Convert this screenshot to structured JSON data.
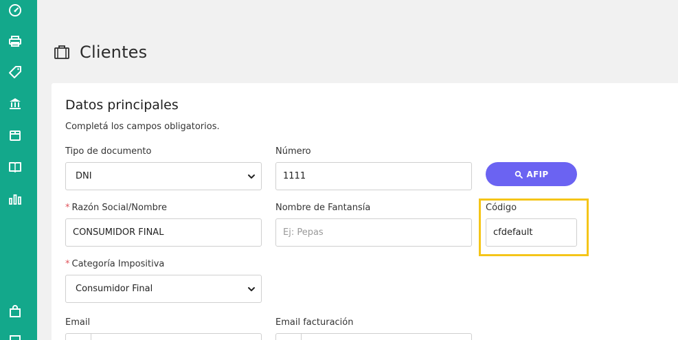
{
  "sidebar": {
    "items": [
      {
        "icon": "dashboard-gauge-icon"
      },
      {
        "icon": "printer-icon"
      },
      {
        "icon": "tag-icon"
      },
      {
        "icon": "bank-icon"
      },
      {
        "icon": "box-icon"
      },
      {
        "icon": "book-icon"
      },
      {
        "icon": "bar-chart-icon"
      }
    ],
    "bottom_items": [
      {
        "icon": "shopping-bag-icon"
      },
      {
        "icon": "more-icon"
      }
    ],
    "color": "#13a88b"
  },
  "header": {
    "title": "Clientes",
    "icon": "briefcase-icon"
  },
  "form": {
    "section_title": "Datos principales",
    "section_subtitle": "Completá los campos obligatorios.",
    "tipo_documento": {
      "label": "Tipo de documento",
      "value": "DNI"
    },
    "numero": {
      "label": "Número",
      "value": "1111"
    },
    "afip_button": {
      "label": "AFIP",
      "icon": "search-icon",
      "color": "#6b63f2"
    },
    "razon_social": {
      "required_mark": "*",
      "label": "Razón Social/Nombre",
      "value": "CONSUMIDOR FINAL"
    },
    "nombre_fantasia": {
      "label": "Nombre de Fantansía",
      "placeholder": "Ej: Pepas"
    },
    "codigo": {
      "label": "Código",
      "value": "cfdefault",
      "highlight_color": "#f5c518"
    },
    "categoria_impositiva": {
      "required_mark": "*",
      "label": "Categoría Impositiva",
      "value": "Consumidor Final"
    },
    "email": {
      "label": "Email"
    },
    "email_facturacion": {
      "label": "Email facturación"
    }
  }
}
